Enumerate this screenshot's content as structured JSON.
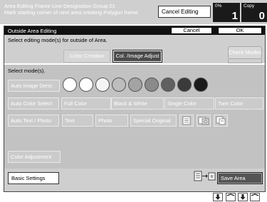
{
  "status": {
    "line1": "Area Editing     Frame Line Designation     Group 01",
    "line2": "Mark starting corner of next area creating Polygon frame."
  },
  "cancel_editing_label": "Cancel Editing",
  "counter_percent": {
    "label": "0%",
    "value": "1"
  },
  "counter_copy": {
    "label": "Copy",
    "value": "0"
  },
  "dialog": {
    "title": "Outside Area Editing",
    "cancel_label": "Cancel",
    "ok_label": "OK",
    "instruction": "Select editing mode(s) for outside of Area.",
    "tabs": {
      "color_creation": "Color Creation",
      "col_image_adjust": "Col. /Image Adjust"
    },
    "check_modes_label": "Check Modes",
    "select_modes_label": "Select mode(s).",
    "auto_image_dens": "Auto Image Dens",
    "density_levels": [
      "#ffffff",
      "#ffffff",
      "#f4f4f4",
      "#bdbdbd",
      "#a3a3a3",
      "#8a8a8a",
      "#606060",
      "#3a3a3a",
      "#1a1a1a"
    ],
    "color_modes": [
      "Auto Color Select",
      "Full Color",
      "Black & White",
      "Single Color",
      "Twin Color"
    ],
    "original_modes": [
      "Auto Text / Photo",
      "Text",
      "Photo",
      "Special Original"
    ],
    "original_icons": [
      "text-mode-icon",
      "photo-mode-icon",
      "map-mode-icon"
    ],
    "color_adjustment": "Color Adjustment",
    "basic_settings": "Basic Settings",
    "save_area": "Save Area",
    "transfer_icon": "copy-to-memory-icon"
  },
  "bottom_arrows": [
    "down-arrow-icon",
    "up-arrow-icon",
    "down-arrow-icon",
    "up-arrow-icon"
  ]
}
